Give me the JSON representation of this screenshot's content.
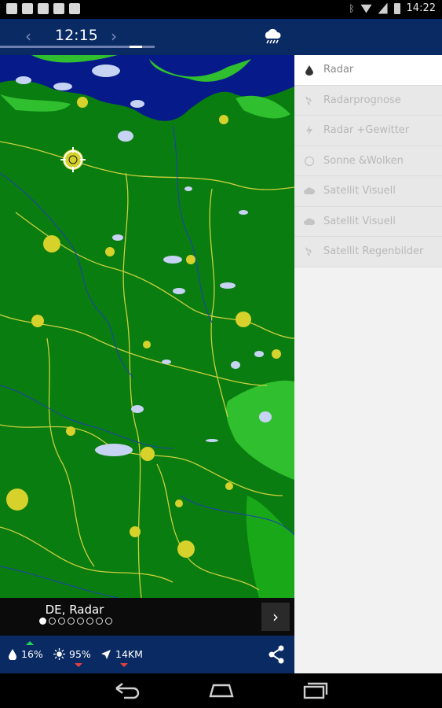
{
  "status_bar": {
    "time": "14:22",
    "icons": [
      "chat-icon",
      "image-icon",
      "mail-icon",
      "clipboard-icon",
      "camera-icon",
      "bluetooth-icon",
      "wifi-icon",
      "signal-icon",
      "battery-icon"
    ]
  },
  "toolbar": {
    "time": "12:15",
    "prev_icon": "chevron-left-icon",
    "next_icon": "chevron-right-icon",
    "layers_icon": "cloud-rain-icon",
    "progress": 0.92
  },
  "location": {
    "label": "DE, Radar",
    "page_count": 8,
    "active_page": 0,
    "next_icon": "chevron-right-icon"
  },
  "info": {
    "precipitation": "16%",
    "sun": "95%",
    "wind": "14KM",
    "precipitation_trend": "up",
    "sun_trend": "down",
    "wind_trend": "down"
  },
  "menu": {
    "items": [
      {
        "label": "Radar",
        "icon": "drop-icon",
        "active": true
      },
      {
        "label": "Radarprognose",
        "icon": "rain-drops-icon",
        "active": false
      },
      {
        "label": "Radar +Gewitter",
        "icon": "lightning-icon",
        "active": false
      },
      {
        "label": "Sonne &Wolken",
        "icon": "sun-circle-icon",
        "active": false
      },
      {
        "label": "Satellit Visuell",
        "icon": "cloud-icon",
        "active": false
      },
      {
        "label": "Satellit Visuell",
        "icon": "cloud-icon",
        "active": false
      },
      {
        "label": "Satellit Regenbilder",
        "icon": "rain-drops-icon",
        "active": false
      }
    ]
  },
  "colors": {
    "primary": "#0a2a63",
    "map_land": "#0a7d10",
    "map_land_light": "#2fbf2f",
    "map_water": "#061a8a",
    "city": "#d6d22b",
    "border": "#c9cf3e",
    "river": "#1d3fb5",
    "rain_light": "#c7d3f2",
    "trend_up": "#1fd655",
    "trend_down": "#e24040"
  }
}
